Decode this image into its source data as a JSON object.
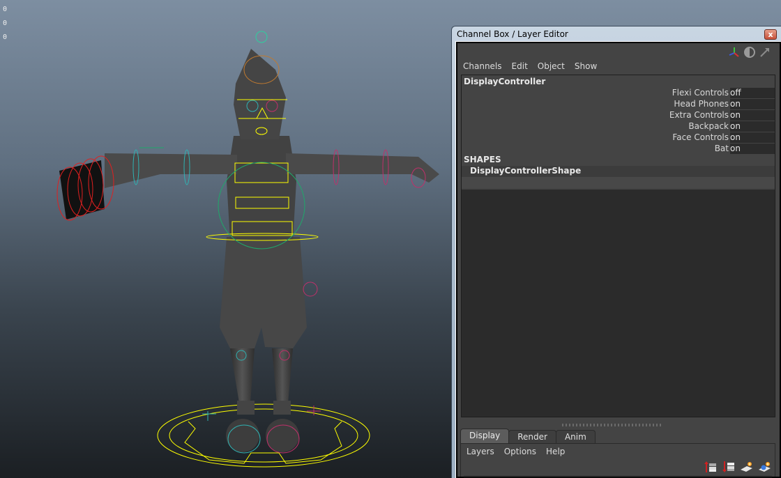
{
  "viewport": {
    "hud_values": [
      "0",
      "0",
      "0"
    ],
    "colors": {
      "body": "#3f3f3f",
      "control_yellow": "#ffff00",
      "control_cyan": "#2fb3b3",
      "control_magenta": "#c0306a",
      "control_red": "#e02020",
      "control_green": "#1fa86a",
      "control_orange": "#c07a30"
    }
  },
  "window": {
    "title": "Channel Box / Layer Editor",
    "close_label": "x",
    "top_icons": [
      "manipulator-axes-icon",
      "speed-dial-icon",
      "arrow-icon"
    ],
    "menu": [
      "Channels",
      "Edit",
      "Object",
      "Show"
    ],
    "object_name": "DisplayController",
    "attributes": [
      {
        "label": "Flexi Controls",
        "value": "off"
      },
      {
        "label": "Head Phones",
        "value": "on"
      },
      {
        "label": "Extra Controls",
        "value": "on"
      },
      {
        "label": "Backpack",
        "value": "on"
      },
      {
        "label": "Face Controls",
        "value": "on"
      },
      {
        "label": "Bat",
        "value": "on"
      }
    ],
    "shapes_header": "SHAPES",
    "shape_name": "DisplayControllerShape",
    "tabs": [
      {
        "label": "Display",
        "active": true
      },
      {
        "label": "Render",
        "active": false
      },
      {
        "label": "Anim",
        "active": false
      }
    ],
    "layer_menu": [
      "Layers",
      "Options",
      "Help"
    ],
    "layer_icons": [
      "move-layer-up-icon",
      "move-layer-down-icon",
      "create-empty-layer-icon",
      "create-layer-from-selected-icon"
    ]
  }
}
